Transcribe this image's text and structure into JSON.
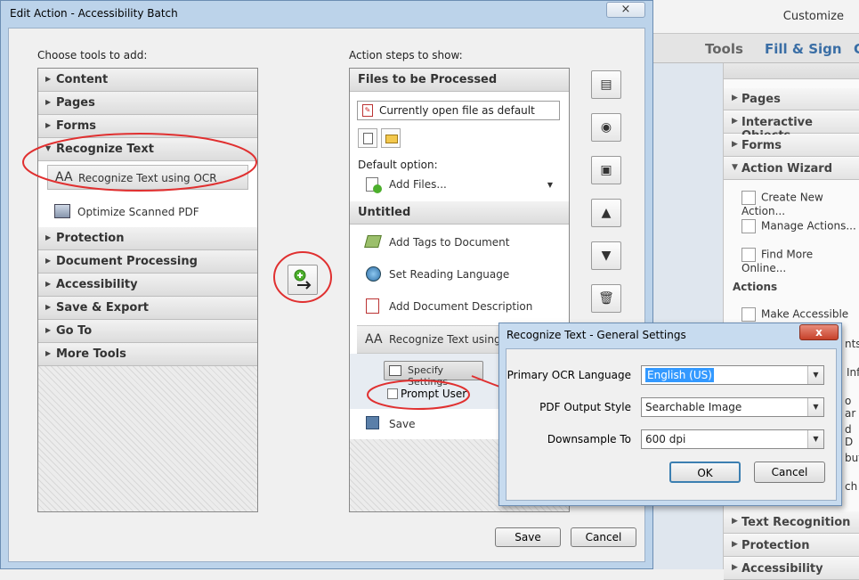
{
  "dialog": {
    "title": "Edit Action - Accessibility Batch",
    "close_icon": "×",
    "left_label": "Choose tools to add:",
    "right_label": "Action steps to show:",
    "tool_sections": [
      {
        "label": "Content"
      },
      {
        "label": "Pages"
      },
      {
        "label": "Forms"
      },
      {
        "label": "Recognize Text",
        "expanded": true
      },
      {
        "label": "Protection"
      },
      {
        "label": "Document Processing"
      },
      {
        "label": "Accessibility"
      },
      {
        "label": "Save & Export"
      },
      {
        "label": "Go To"
      },
      {
        "label": "More Tools"
      }
    ],
    "tool_items": [
      {
        "label": "Recognize Text using OCR",
        "icon": "text-aa-icon"
      },
      {
        "label": "Optimize Scanned PDF",
        "icon": "scanner-icon"
      }
    ],
    "files_header": "Files to be Processed",
    "current_file": "Currently open file as default",
    "default_option_label": "Default option:",
    "add_files": "Add Files...",
    "untitled_header": "Untitled",
    "steps": [
      {
        "label": "Add Tags to Document",
        "icon": "tag-icon"
      },
      {
        "label": "Set Reading Language",
        "icon": "globe-icon"
      },
      {
        "label": "Add Document Description",
        "icon": "document-icon"
      },
      {
        "label": "Recognize Text using O",
        "icon": "text-aa-icon"
      }
    ],
    "specify_settings": "Specify Settings",
    "prompt_user": "Prompt User",
    "save_step": "Save",
    "save_button": "Save",
    "cancel_button": "Cancel"
  },
  "subdialog": {
    "title": "Recognize Text - General Settings",
    "close_icon": "x",
    "fields": [
      {
        "label": "Primary OCR Language",
        "value": "English (US)"
      },
      {
        "label": "PDF Output Style",
        "value": "Searchable Image"
      },
      {
        "label": "Downsample To",
        "value": "600 dpi"
      }
    ],
    "ok_button": "OK",
    "cancel_button": "Cancel"
  },
  "app": {
    "customize": "Customize",
    "tabs": [
      "Tools",
      "Fill & Sign",
      "C"
    ],
    "right_sections": [
      "Pages",
      "Interactive Objects",
      "Forms",
      "Action Wizard",
      "Text Recognition",
      "Protection",
      "Accessibility"
    ],
    "wizard_items": [
      "Create New Action...",
      "Manage Actions...",
      "Find More Online..."
    ],
    "actions_label": "Actions",
    "action_items": [
      "Make Accessible"
    ],
    "truncated_items": [
      "nts",
      "Inf",
      "o ar",
      "d D",
      "but",
      "ch"
    ]
  },
  "colors": {
    "annotation": "#e03030",
    "title_bar": "#bcd3ea",
    "accent_blue": "#3a6ea5"
  }
}
